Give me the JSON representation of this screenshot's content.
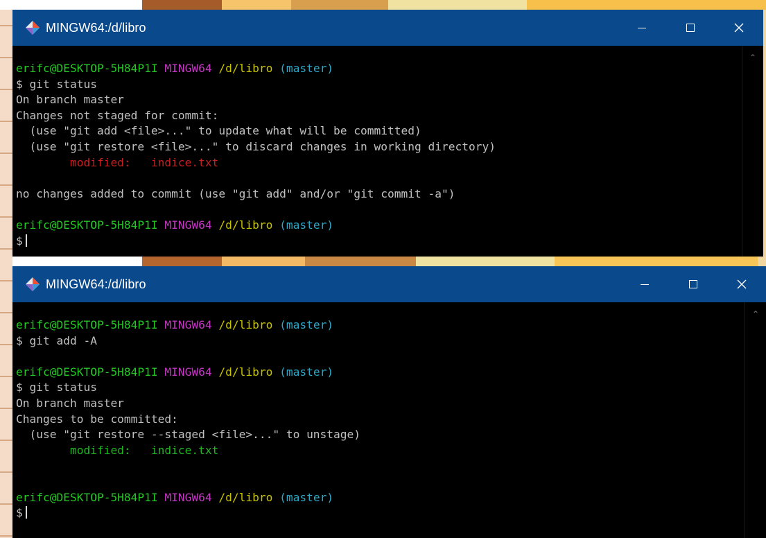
{
  "colors": {
    "titlebar": "#0a4a8c",
    "prompt_user": "#25c725",
    "prompt_host": "#c236c2",
    "prompt_path": "#c7c300",
    "prompt_branch": "#2aa7c7",
    "unstaged": "#c82020",
    "staged": "#20b820"
  },
  "window1": {
    "title": "MINGW64:/d/libro",
    "icon": "git-bash-icon",
    "lines": {
      "p1_user": "erifc@DESKTOP-5H84P1I",
      "p1_host": "MINGW64",
      "p1_path": "/d/libro",
      "p1_branch": "(master)",
      "cmd1": "$ git status",
      "out1": "On branch master",
      "out2": "Changes not staged for commit:",
      "out3": "  (use \"git add <file>...\" to update what will be committed)",
      "out4": "  (use \"git restore <file>...\" to discard changes in working directory)",
      "mod_label": "modified:",
      "mod_file": "indice.txt",
      "out5": "no changes added to commit (use \"git add\" and/or \"git commit -a\")",
      "p2_user": "erifc@DESKTOP-5H84P1I",
      "p2_host": "MINGW64",
      "p2_path": "/d/libro",
      "p2_branch": "(master)",
      "prompt": "$"
    }
  },
  "window2": {
    "title": "MINGW64:/d/libro",
    "icon": "git-bash-icon",
    "lines": {
      "p1_user": "erifc@DESKTOP-5H84P1I",
      "p1_host": "MINGW64",
      "p1_path": "/d/libro",
      "p1_branch": "(master)",
      "cmd1": "$ git add -A",
      "p2_user": "erifc@DESKTOP-5H84P1I",
      "p2_host": "MINGW64",
      "p2_path": "/d/libro",
      "p2_branch": "(master)",
      "cmd2": "$ git status",
      "out1": "On branch master",
      "out2": "Changes to be committed:",
      "out3": "  (use \"git restore --staged <file>...\" to unstage)",
      "mod_label": "modified:",
      "mod_file": "indice.txt",
      "p3_user": "erifc@DESKTOP-5H84P1I",
      "p3_host": "MINGW64",
      "p3_path": "/d/libro",
      "p3_branch": "(master)",
      "prompt": "$"
    }
  }
}
